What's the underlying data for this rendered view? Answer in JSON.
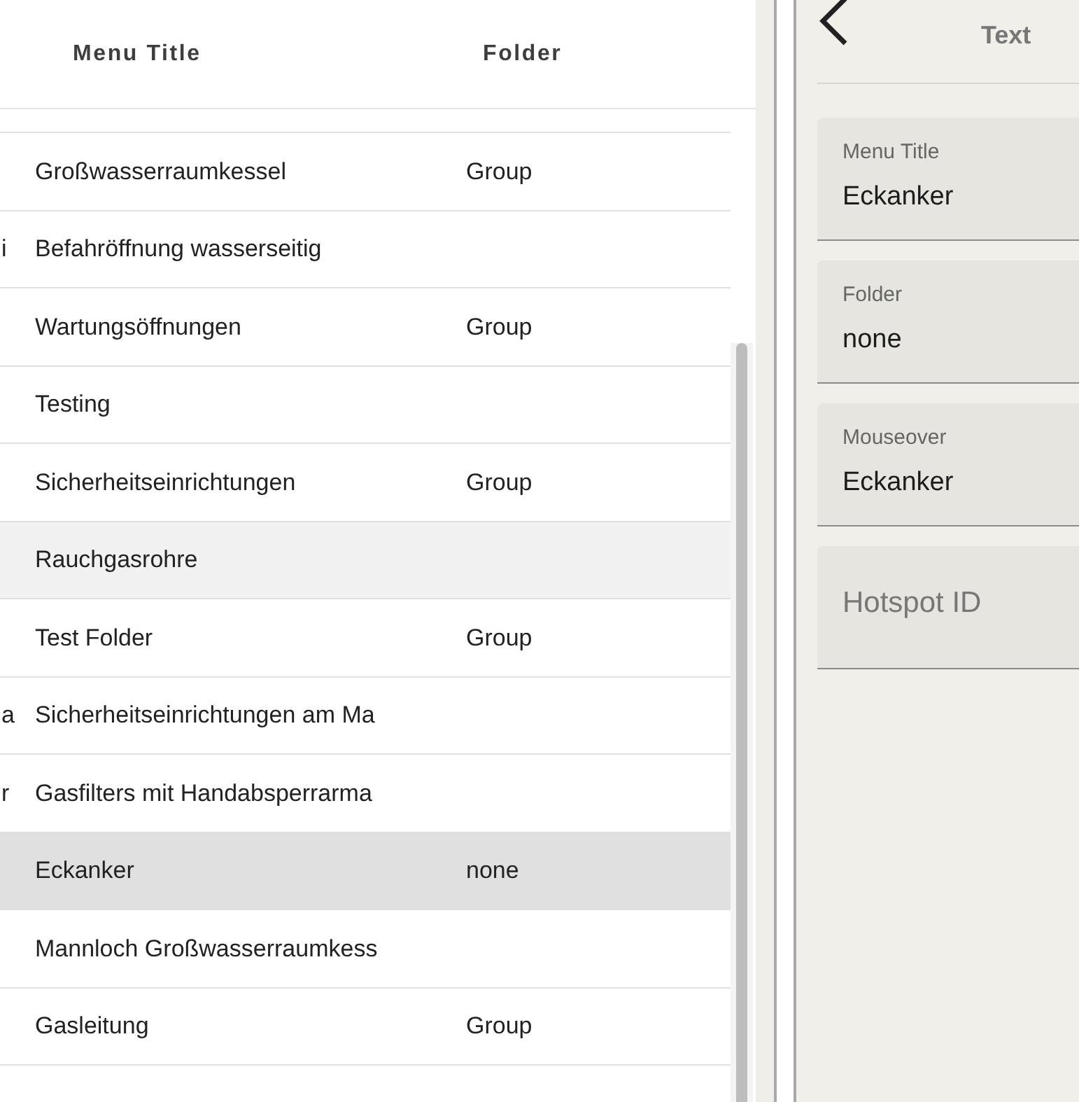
{
  "table": {
    "columns": [
      "Menu Title",
      "Folder"
    ],
    "rows": [
      {
        "column_1": "",
        "title": "Großwasserraumkessel",
        "folder": "Group",
        "selected": false,
        "hovered": false
      },
      {
        "column_1": "i",
        "title": "Befahröffnung wasserseitig",
        "folder": "",
        "selected": false,
        "hovered": false
      },
      {
        "column_1": "",
        "title": "Wartungsöffnungen",
        "folder": "Group",
        "selected": false,
        "hovered": false
      },
      {
        "column_1": "",
        "title": "Testing",
        "folder": "",
        "selected": false,
        "hovered": false
      },
      {
        "column_1": "",
        "title": "Sicherheitseinrichtungen",
        "folder": "Group",
        "selected": false,
        "hovered": false
      },
      {
        "column_1": "",
        "title": "Rauchgasrohre",
        "folder": "",
        "selected": false,
        "hovered": true
      },
      {
        "column_1": "",
        "title": "Test Folder",
        "folder": "Group",
        "selected": false,
        "hovered": false
      },
      {
        "column_1": "a",
        "title": "Sicherheitseinrichtungen am Ma",
        "folder": "",
        "selected": false,
        "hovered": false
      },
      {
        "column_1": "r",
        "title": "Gasfilters mit Handabsperrarma",
        "folder": "",
        "selected": false,
        "hovered": false
      },
      {
        "column_1": "",
        "title": "Eckanker",
        "folder": "none",
        "selected": true,
        "hovered": false
      },
      {
        "column_1": "",
        "title": "Mannloch Großwasserraumkess",
        "folder": "",
        "selected": false,
        "hovered": false
      },
      {
        "column_1": "",
        "title": "Gasleitung",
        "folder": "Group",
        "selected": false,
        "hovered": false
      }
    ]
  },
  "detail": {
    "title": "Text",
    "fields": [
      {
        "label": "Menu Title",
        "value": "Eckanker"
      },
      {
        "label": "Folder",
        "value": "none"
      },
      {
        "label": "Mouseover",
        "value": "Eckanker"
      },
      {
        "placeholder": "Hotspot ID"
      }
    ]
  }
}
